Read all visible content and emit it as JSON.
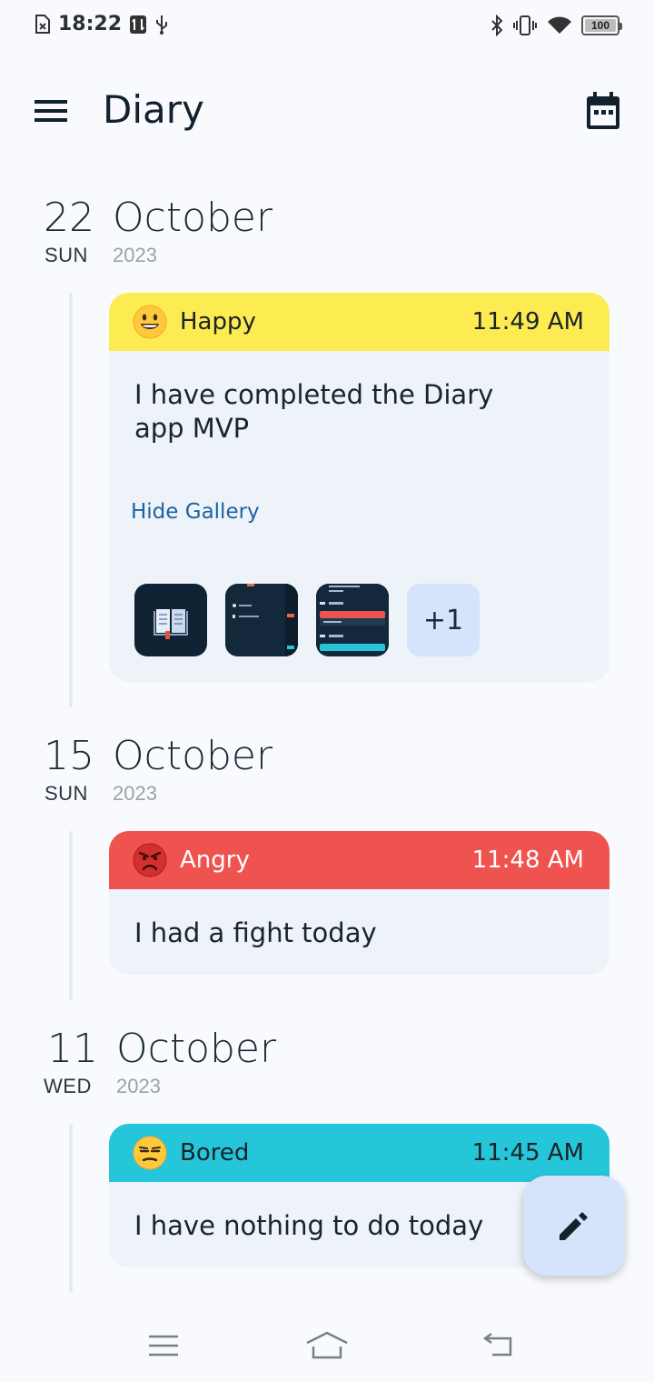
{
  "status_bar": {
    "time": "18:22",
    "battery": "100",
    "battery_level": 1.0,
    "icons": [
      "sim-error-icon",
      "data-saver-icon",
      "usb-icon",
      "bluetooth-icon",
      "vibrate-icon",
      "wifi-icon",
      "battery-icon"
    ]
  },
  "app_bar": {
    "title": "Diary",
    "menu_icon": "hamburger-menu-icon",
    "calendar_icon": "calendar-icon"
  },
  "groups": [
    {
      "day": "22",
      "weekday": "SUN",
      "month": "October",
      "year": "2023",
      "entries": [
        {
          "mood": "Happy",
          "mood_icon": "smiling-face-icon",
          "color": "#fdeb52",
          "text_color": "#1b2228",
          "time": "11:49 AM",
          "text": "I have completed the Diary app MVP",
          "gallery_toggle": "Hide Gallery",
          "more_count": "+1"
        }
      ]
    },
    {
      "day": "15",
      "weekday": "SUN",
      "month": "October",
      "year": "2023",
      "entries": [
        {
          "mood": "Angry",
          "mood_icon": "angry-face-icon",
          "color": "#ef5350",
          "text_color": "#ffffff",
          "time": "11:48 AM",
          "text": "I had a fight today"
        }
      ]
    },
    {
      "day": "11",
      "weekday": "WED",
      "month": "October",
      "year": "2023",
      "entries": [
        {
          "mood": "Bored",
          "mood_icon": "unamused-face-icon",
          "color": "#26c6da",
          "text_color": "#1b2228",
          "time": "11:45 AM",
          "text": "I have nothing to do today"
        }
      ]
    }
  ],
  "fab": {
    "icon": "pencil-icon"
  },
  "nav_bar": {
    "icons": [
      "recents-icon",
      "home-icon",
      "back-icon"
    ]
  }
}
